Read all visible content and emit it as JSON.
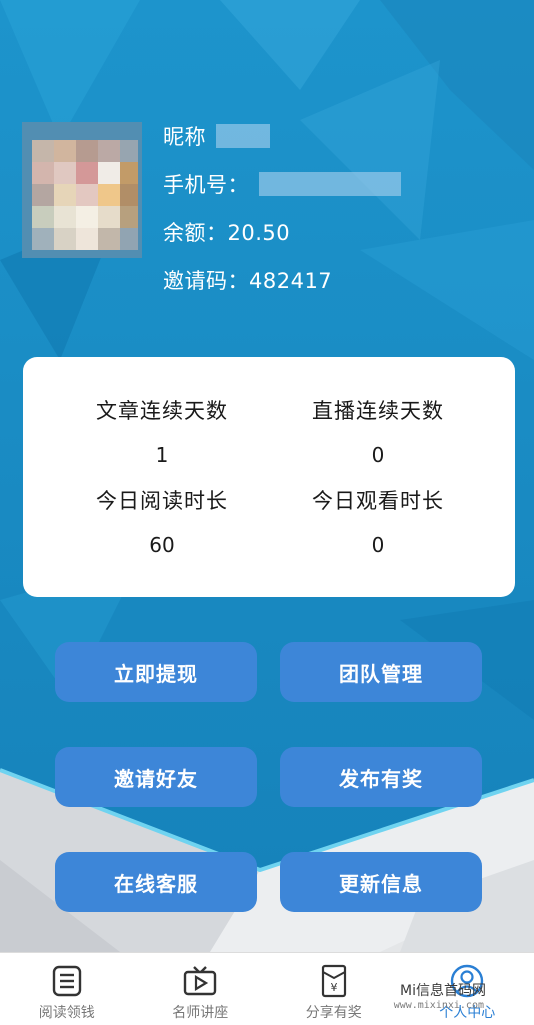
{
  "profile": {
    "nickname_label": "昵称",
    "phone_label": "手机号：",
    "balance": "余额：20.50",
    "invite_code": "邀请码：482417"
  },
  "stats": {
    "article_streak_label": "文章连续天数",
    "article_streak_value": "1",
    "live_streak_label": "直播连续天数",
    "live_streak_value": "0",
    "today_read_label": "今日阅读时长",
    "today_read_value": "60",
    "today_watch_label": "今日观看时长",
    "today_watch_value": "0"
  },
  "actions": {
    "withdraw": "立即提现",
    "team": "团队管理",
    "invite": "邀请好友",
    "publish": "发布有奖",
    "support": "在线客服",
    "update": "更新信息"
  },
  "nav": {
    "items": [
      {
        "label": "阅读领钱",
        "icon": "list-icon"
      },
      {
        "label": "名师讲座",
        "icon": "tv-play-icon"
      },
      {
        "label": "分享有奖",
        "icon": "envelope-yen-icon"
      },
      {
        "label": "个人中心",
        "icon": "user-icon"
      }
    ],
    "active_index": 3
  },
  "watermark": {
    "title": "Mi信息首码网",
    "domain": "www.mixinxi.com"
  },
  "colors": {
    "background": "#1b8fc6",
    "button": "#3d86d8",
    "active_nav": "#2a7fd4"
  }
}
